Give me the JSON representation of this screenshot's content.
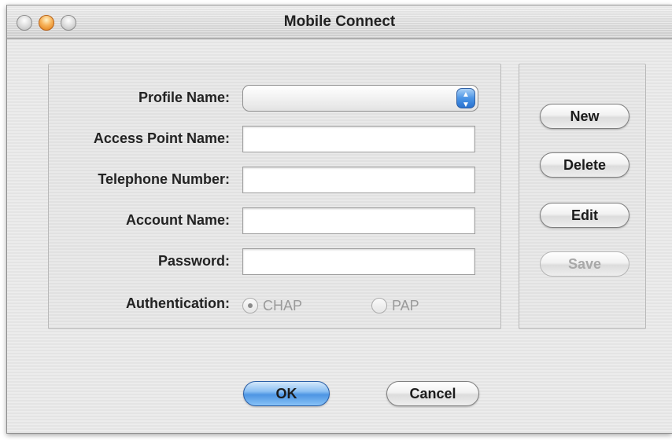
{
  "window": {
    "title": "Mobile Connect"
  },
  "form": {
    "profile_name_label": "Profile Name:",
    "profile_name_value": "",
    "access_point_label": "Access Point Name:",
    "access_point_value": "",
    "telephone_label": "Telephone Number:",
    "telephone_value": "",
    "account_label": "Account Name:",
    "account_value": "",
    "password_label": "Password:",
    "password_value": "",
    "authentication_label": "Authentication:",
    "auth_options": [
      {
        "label": "CHAP",
        "selected": true
      },
      {
        "label": "PAP",
        "selected": false
      }
    ]
  },
  "side_buttons": {
    "new": "New",
    "delete": "Delete",
    "edit": "Edit",
    "save": "Save"
  },
  "footer": {
    "ok": "OK",
    "cancel": "Cancel"
  }
}
